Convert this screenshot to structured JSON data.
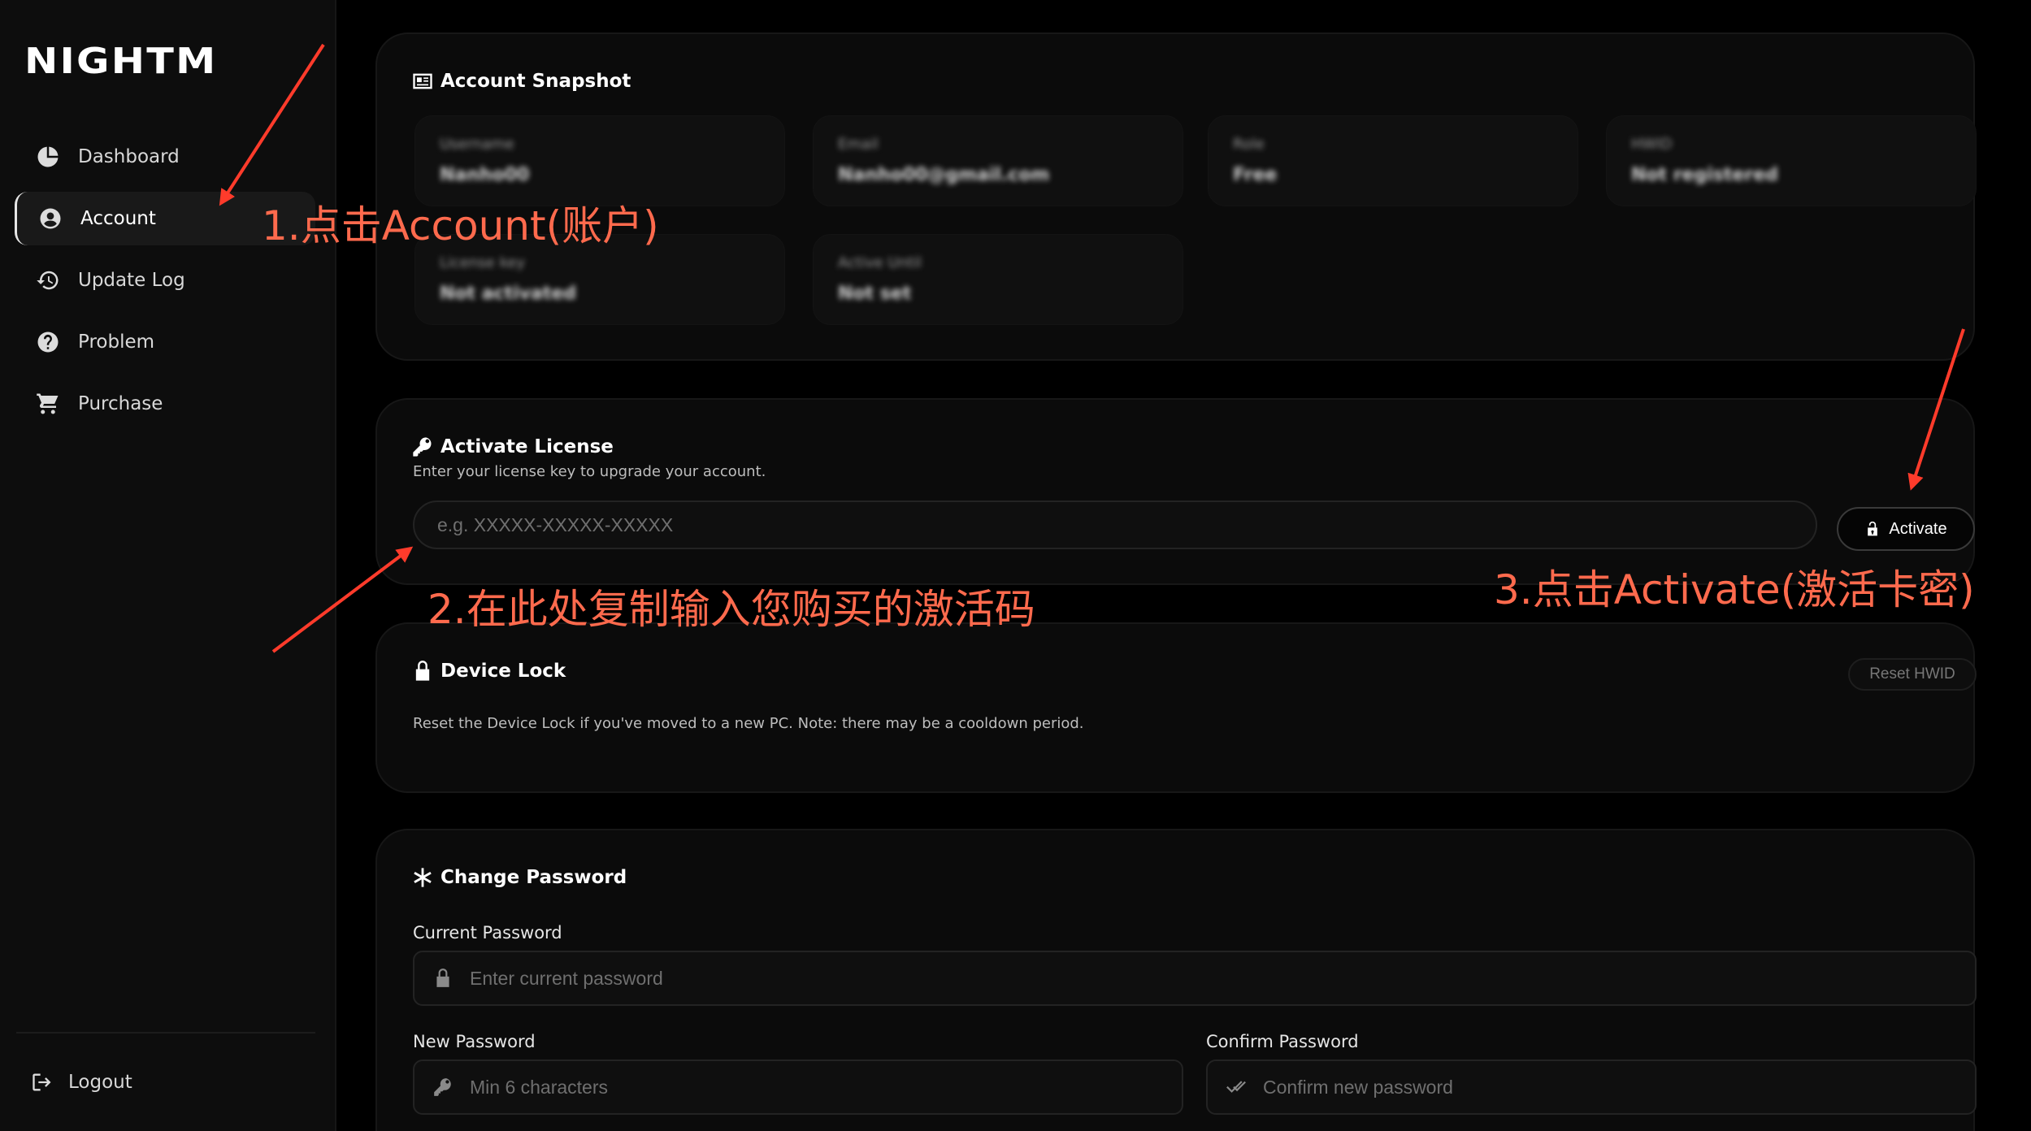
{
  "brand": {
    "logo": "NIGHTM"
  },
  "sidebar": {
    "items": [
      {
        "label": "Dashboard",
        "icon": "pie-chart-icon"
      },
      {
        "label": "Account",
        "icon": "user-circle-icon",
        "active": true
      },
      {
        "label": "Update Log",
        "icon": "history-icon"
      },
      {
        "label": "Problem",
        "icon": "question-circle-icon"
      },
      {
        "label": "Purchase",
        "icon": "shopping-cart-icon"
      }
    ],
    "logout_label": "Logout"
  },
  "snapshot": {
    "title": "Account Snapshot",
    "tiles": [
      {
        "label": "Username",
        "value": "Nanho00"
      },
      {
        "label": "Email",
        "value": "Nanho00@gmail.com"
      },
      {
        "label": "Role",
        "value": "Free"
      },
      {
        "label": "HWID",
        "value": "Not registered"
      },
      {
        "label": "License key",
        "value": "Not activated"
      },
      {
        "label": "Active Until",
        "value": "Not set"
      }
    ]
  },
  "license": {
    "title": "Activate License",
    "subtitle": "Enter your license key to upgrade your account.",
    "placeholder": "e.g. XXXXX-XXXXX-XXXXX",
    "button": "Activate"
  },
  "device_lock": {
    "title": "Device Lock",
    "description": "Reset the Device Lock if you've moved to a new PC. Note: there may be a cooldown period.",
    "button": "Reset HWID"
  },
  "password": {
    "title": "Change Password",
    "current_label": "Current Password",
    "current_placeholder": "Enter current password",
    "new_label": "New Password",
    "new_placeholder": "Min 6 characters",
    "confirm_label": "Confirm Password",
    "confirm_placeholder": "Confirm new password"
  },
  "annotations": {
    "step1": "1.点击Account(账户)",
    "step2": "2.在此处复制输入您购买的激活码",
    "step3": "3.点击Activate(激活卡密)",
    "color": "#ff6a4d"
  }
}
